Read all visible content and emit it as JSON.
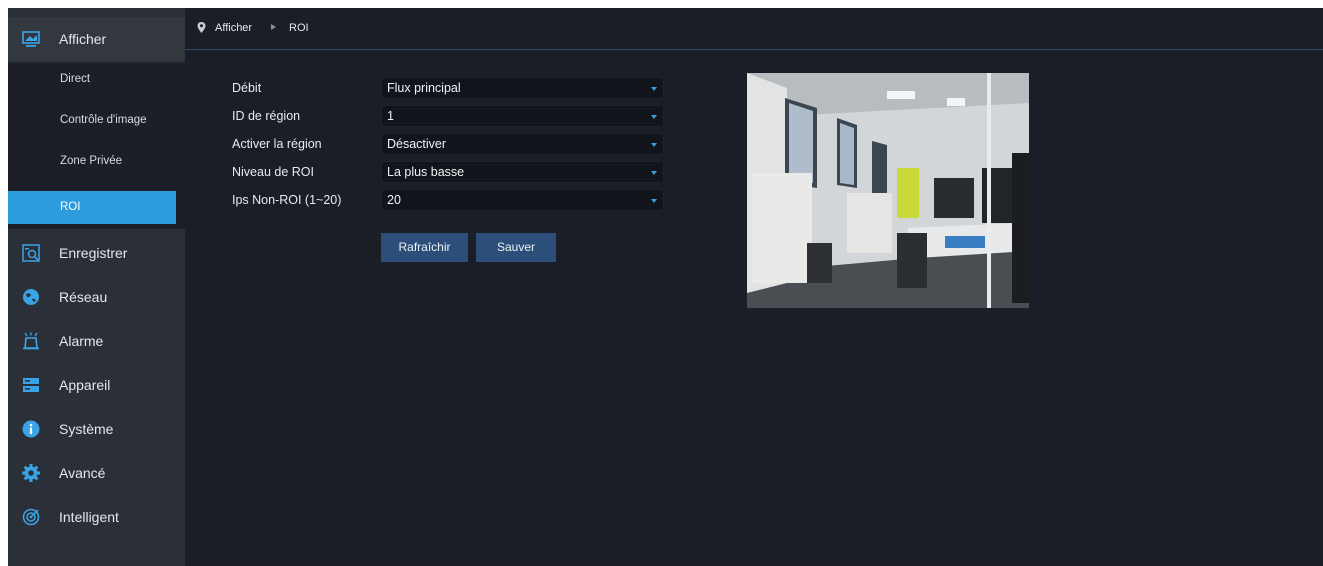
{
  "sidebar": {
    "top_item": {
      "label": "Afficher",
      "icon": "monitor-icon"
    },
    "sub_items": [
      {
        "label": "Direct"
      },
      {
        "label": "Contrôle d'image"
      },
      {
        "label": "Zone Privée"
      },
      {
        "label": "ROI",
        "active": true
      }
    ],
    "items": [
      {
        "label": "Enregistrer",
        "icon": "record-search-icon"
      },
      {
        "label": "Réseau",
        "icon": "globe-icon"
      },
      {
        "label": "Alarme",
        "icon": "alarm-icon"
      },
      {
        "label": "Appareil",
        "icon": "device-icon"
      },
      {
        "label": "Système",
        "icon": "info-icon"
      },
      {
        "label": "Avancé",
        "icon": "gear-icon"
      },
      {
        "label": "Intelligent",
        "icon": "target-icon"
      }
    ]
  },
  "breadcrumb": {
    "root": "Afficher",
    "current": "ROI",
    "icon": "location-pin-icon"
  },
  "form": {
    "fields": [
      {
        "label": "Débit",
        "value": "Flux principal"
      },
      {
        "label": "ID de région",
        "value": "1"
      },
      {
        "label": "Activer la région",
        "value": "Désactiver"
      },
      {
        "label": "Niveau de ROI",
        "value": "La plus basse"
      },
      {
        "label": "Ips Non-ROI (1~20)",
        "value": "20"
      }
    ],
    "refresh_label": "Rafraîchir",
    "save_label": "Sauver"
  },
  "colors": {
    "accent": "#2d9cdc",
    "background": "#1b1e26",
    "sidebar": "#2b2f37",
    "button": "#2c4f7a"
  }
}
